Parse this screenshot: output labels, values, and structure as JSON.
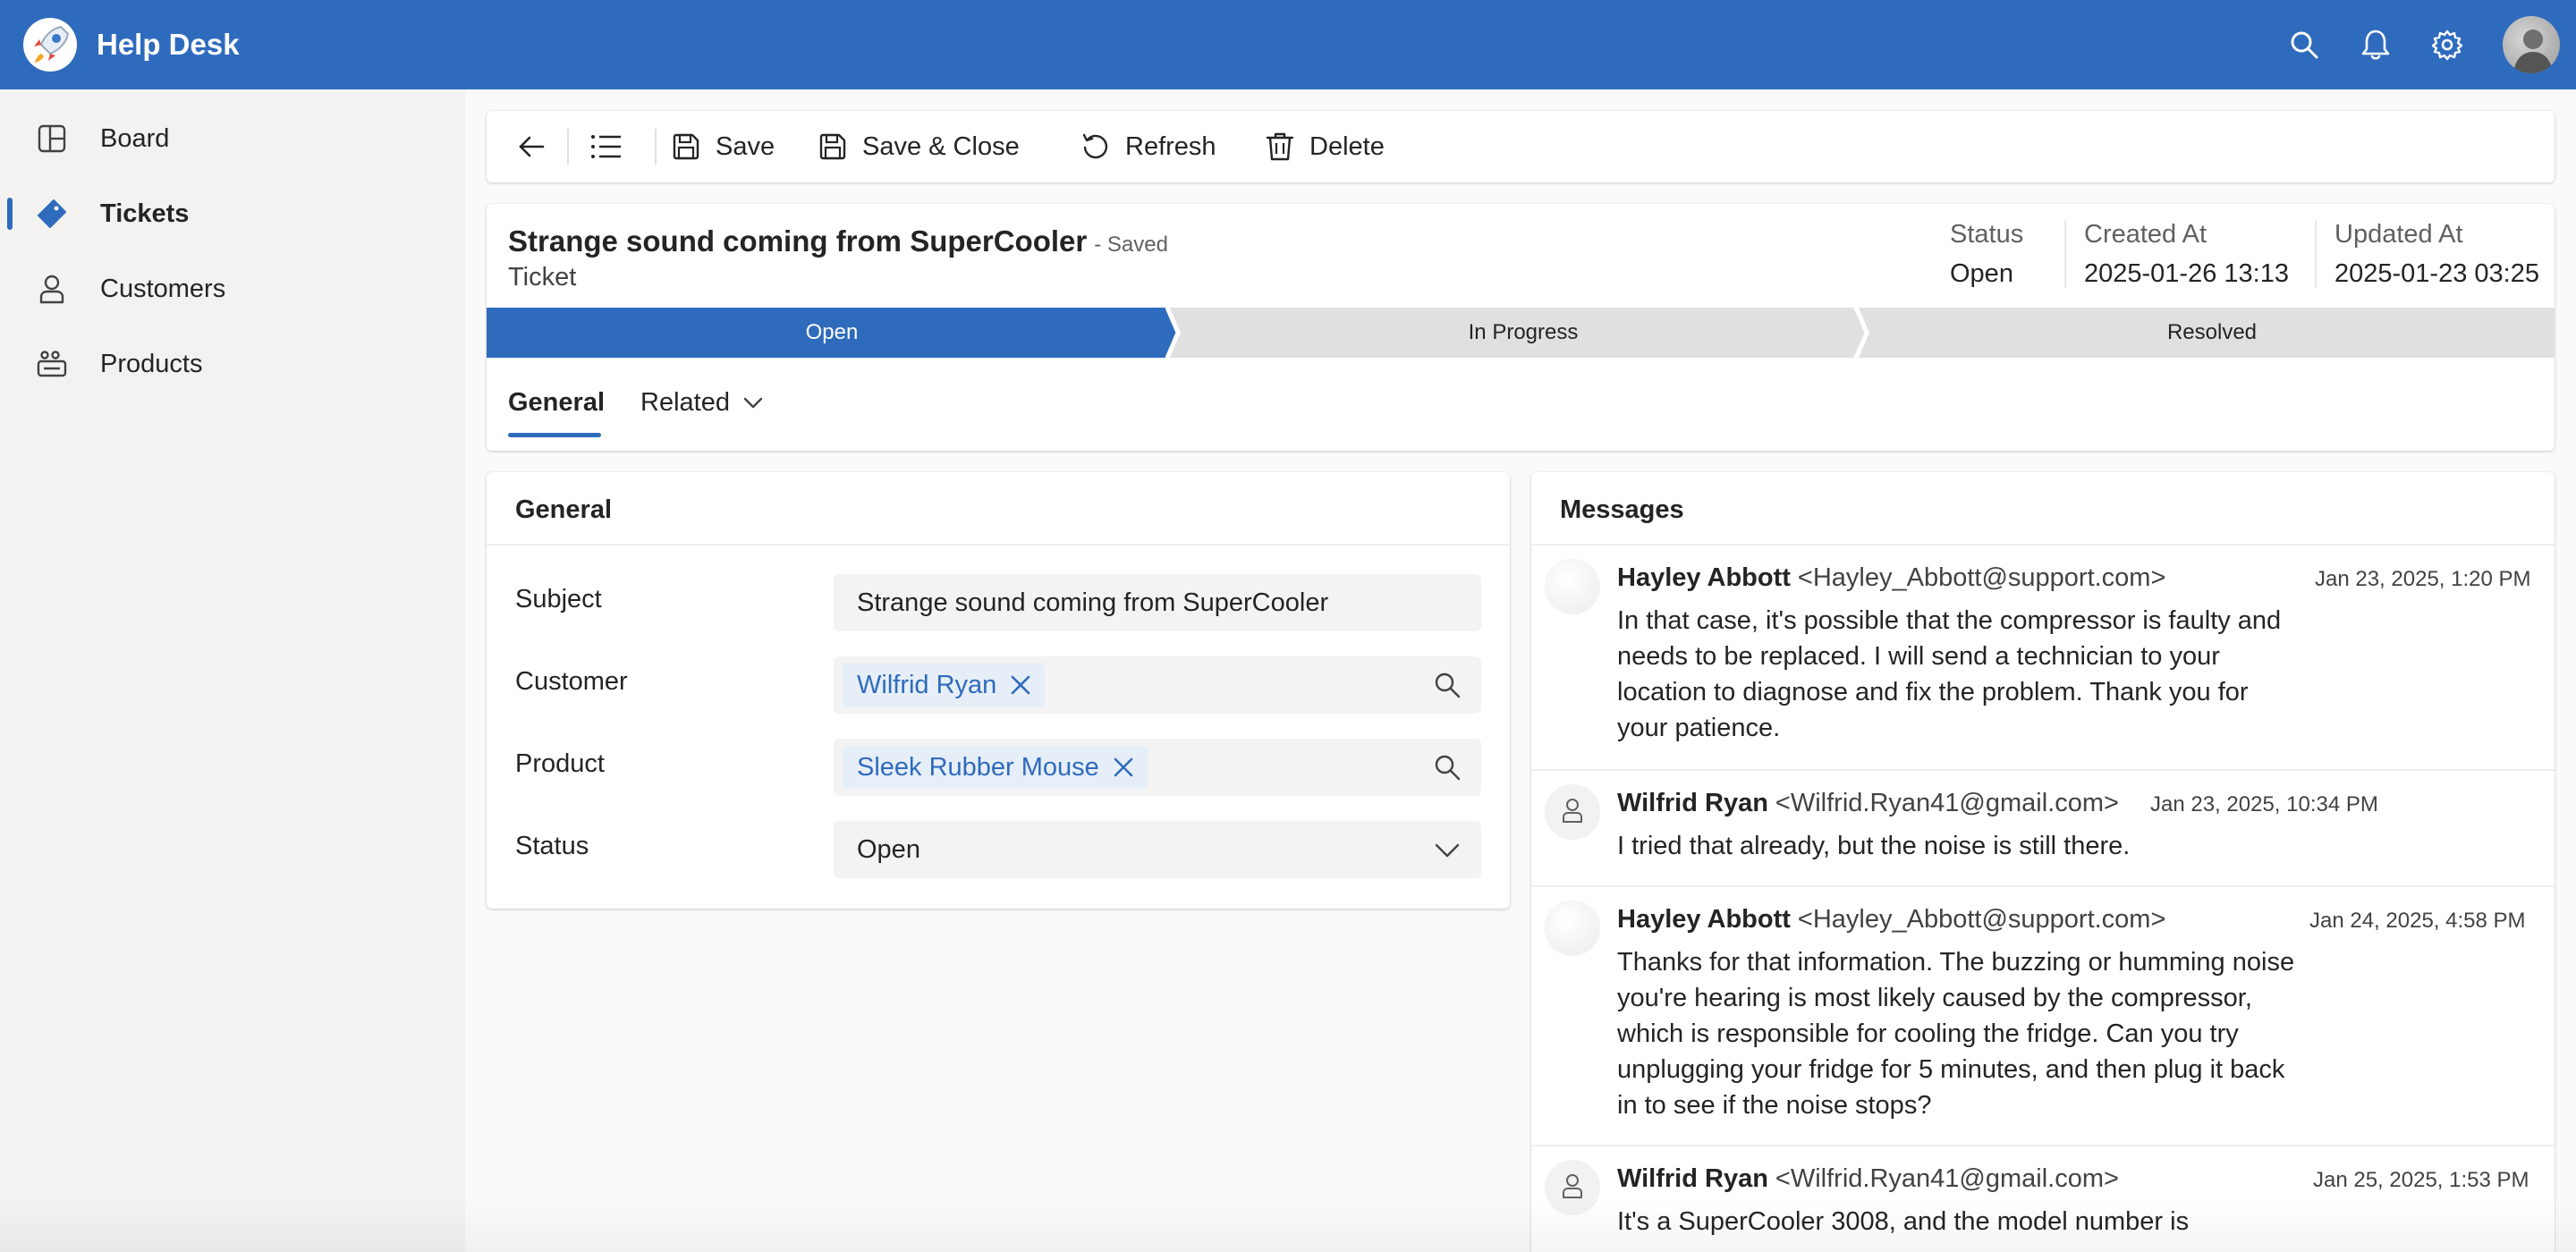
{
  "app": {
    "title": "Help Desk"
  },
  "sidebar": {
    "items": [
      {
        "label": "Board",
        "icon": "board-icon"
      },
      {
        "label": "Tickets",
        "icon": "ticket-icon",
        "active": true
      },
      {
        "label": "Customers",
        "icon": "person-icon"
      },
      {
        "label": "Products",
        "icon": "products-icon"
      }
    ]
  },
  "toolbar": {
    "save_label": "Save",
    "save_close_label": "Save & Close",
    "refresh_label": "Refresh",
    "delete_label": "Delete"
  },
  "ticket": {
    "title": "Strange sound coming from SuperCooler",
    "saved": "- Saved",
    "entity": "Ticket",
    "meta": [
      {
        "label": "Status",
        "value": "Open"
      },
      {
        "label": "Created At",
        "value": "2025-01-26 13:13"
      },
      {
        "label": "Updated At",
        "value": "2025-01-23 03:25"
      }
    ],
    "stages": [
      {
        "label": "Open",
        "active": true
      },
      {
        "label": "In Progress",
        "active": false
      },
      {
        "label": "Resolved",
        "active": false
      }
    ],
    "tabs": [
      {
        "label": "General",
        "active": true
      },
      {
        "label": "Related",
        "active": false
      }
    ]
  },
  "general": {
    "title": "General",
    "subject_label": "Subject",
    "subject_value": "Strange sound coming from SuperCooler",
    "customer_label": "Customer",
    "customer_value": "Wilfrid Ryan",
    "product_label": "Product",
    "product_value": "Sleek Rubber Mouse",
    "status_label": "Status",
    "status_value": "Open"
  },
  "messages": {
    "title": "Messages",
    "items": [
      {
        "name": "Hayley Abbott",
        "email": "<Hayley_Abbott@support.com>",
        "date": "Jan 23, 2025, 1:20 PM",
        "body": "In that case, it's possible that the compressor is faulty and needs to be replaced. I will send a technician to your location to diagnose and fix the problem. Thank you for your patience."
      },
      {
        "name": "Wilfrid Ryan",
        "email": "<Wilfrid.Ryan41@gmail.com>",
        "date": "Jan 23, 2025, 10:34 PM",
        "body": "I tried that already, but the noise is still there."
      },
      {
        "name": "Hayley Abbott",
        "email": "<Hayley_Abbott@support.com>",
        "date": "Jan 24, 2025, 4:58 PM",
        "body": "Thanks for that information. The buzzing or humming noise you're hearing is most likely caused by the compressor, which is responsible for cooling the fridge. Can you try unplugging your fridge for 5 minutes, and then plug it back in to see if the noise stops?"
      },
      {
        "name": "Wilfrid Ryan",
        "email": "<Wilfrid.Ryan41@gmail.com>",
        "date": "Jan 25, 2025, 1:53 PM",
        "body": "It's a SuperCooler 3008, and the model number is"
      }
    ]
  },
  "colors": {
    "brand": "#2f6bbd",
    "stage_inactive": "#e0e0e0"
  }
}
